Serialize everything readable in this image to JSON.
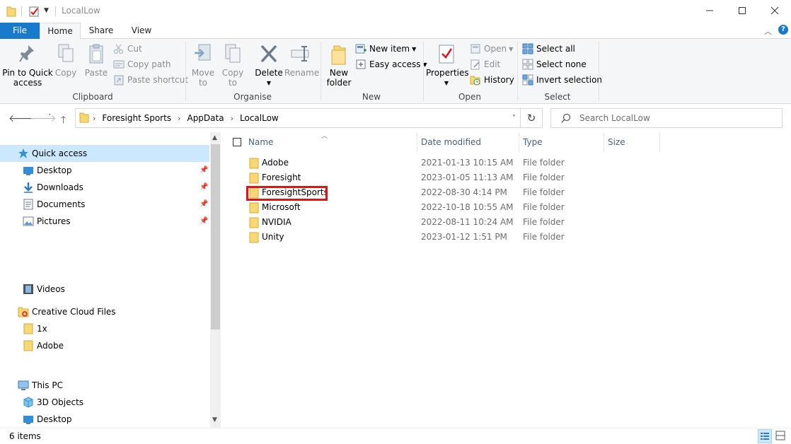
{
  "window": {
    "title": "LocalLow"
  },
  "tabs": [
    {
      "label": "File"
    },
    {
      "label": "Home"
    },
    {
      "label": "Share"
    },
    {
      "label": "View"
    }
  ],
  "ribbon": {
    "clipboard": {
      "group_label": "Clipboard",
      "pin_label_1": "Pin to Quick",
      "pin_label_2": "access",
      "copy_label": "Copy",
      "paste_label": "Paste",
      "cut_label": "Cut",
      "copy_path_label": "Copy path",
      "paste_shortcut_label": "Paste shortcut"
    },
    "organise": {
      "group_label": "Organise",
      "move_label_1": "Move",
      "move_label_2": "to",
      "copy_to_label_1": "Copy",
      "copy_to_label_2": "to",
      "delete_label": "Delete",
      "rename_label": "Rename"
    },
    "new": {
      "group_label": "New",
      "new_folder_label_1": "New",
      "new_folder_label_2": "folder",
      "new_item_label": "New item",
      "easy_access_label": "Easy access"
    },
    "open": {
      "group_label": "Open",
      "properties_label": "Properties",
      "open_label": "Open",
      "edit_label": "Edit",
      "history_label": "History"
    },
    "select": {
      "group_label": "Select",
      "select_all_label": "Select all",
      "select_none_label": "Select none",
      "invert_label": "Invert selection"
    }
  },
  "address": {
    "crumbs": [
      "Foresight Sports",
      "AppData",
      "LocalLow"
    ]
  },
  "search": {
    "placeholder": "Search LocalLow"
  },
  "navpane": {
    "quick_access": "Quick access",
    "items": [
      {
        "label": "Desktop"
      },
      {
        "label": "Downloads"
      },
      {
        "label": "Documents"
      },
      {
        "label": "Pictures"
      },
      {
        "label": "Videos"
      },
      {
        "label": "Creative Cloud Files"
      },
      {
        "label": "1x"
      },
      {
        "label": "Adobe"
      },
      {
        "label": "This PC"
      },
      {
        "label": "3D Objects"
      },
      {
        "label": "Desktop"
      }
    ]
  },
  "columns": {
    "name": "Name",
    "date": "Date modified",
    "type": "Type",
    "size": "Size"
  },
  "files": [
    {
      "name": "Adobe",
      "date": "2021-01-13 10:15 AM",
      "type": "File folder"
    },
    {
      "name": "Foresight",
      "date": "2023-01-05 11:13 AM",
      "type": "File folder"
    },
    {
      "name": "ForesightSports",
      "date": "2022-08-30 4:14 PM",
      "type": "File folder"
    },
    {
      "name": "Microsoft",
      "date": "2022-10-18 10:55 AM",
      "type": "File folder"
    },
    {
      "name": "NVIDIA",
      "date": "2022-08-11 10:24 AM",
      "type": "File folder"
    },
    {
      "name": "Unity",
      "date": "2023-01-12 1:51 PM",
      "type": "File folder"
    }
  ],
  "status": {
    "count": "6 items"
  },
  "colors": {
    "accent": "#1979ca",
    "folder": "#f8d775",
    "highlight": "#e0131d",
    "selection": "#cce8ff"
  }
}
